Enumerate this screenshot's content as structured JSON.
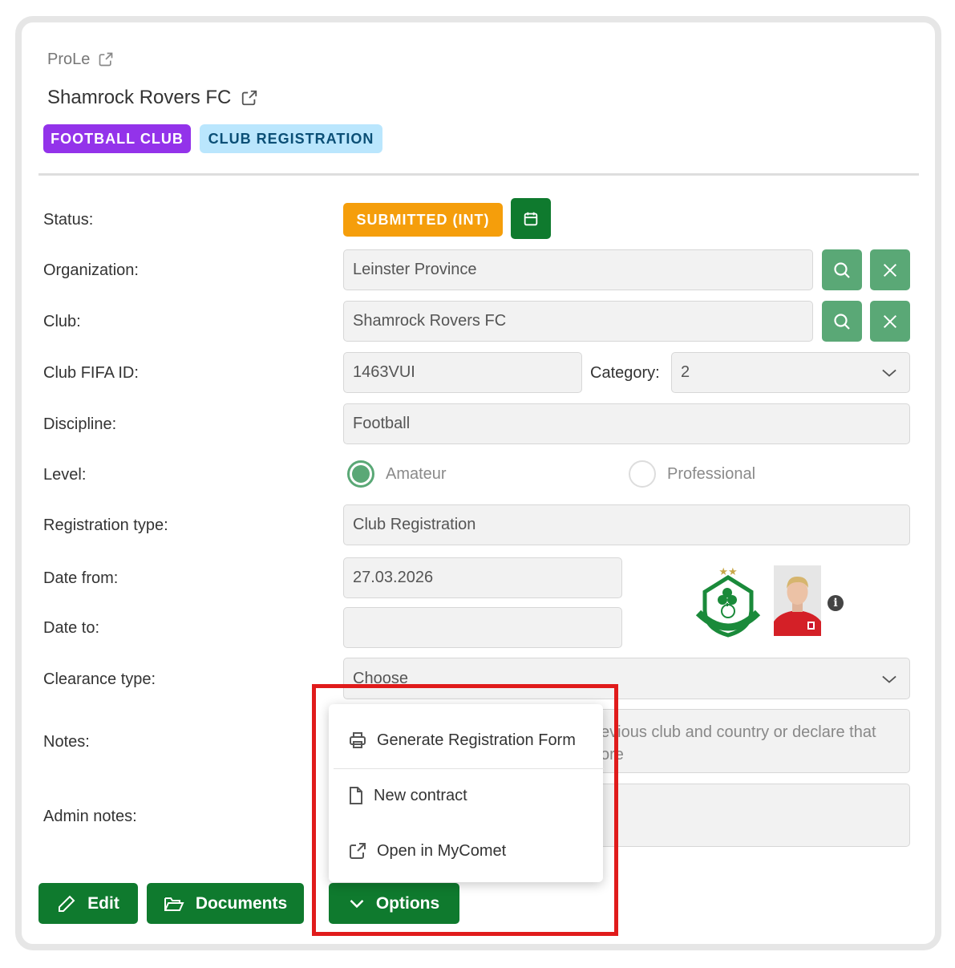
{
  "breadcrumb": {
    "text": "ProLe"
  },
  "header": {
    "title": "Shamrock Rovers FC",
    "badges": [
      "FOOTBALL CLUB",
      "CLUB REGISTRATION"
    ]
  },
  "form": {
    "status": {
      "label": "Status:",
      "value": "SUBMITTED (INT)"
    },
    "organization": {
      "label": "Organization:",
      "value": "Leinster Province"
    },
    "club": {
      "label": "Club:",
      "value": "Shamrock Rovers FC"
    },
    "club_fifa_id": {
      "label": "Club FIFA ID:",
      "value": "1463VUI"
    },
    "category": {
      "label": "Category:",
      "value": "2"
    },
    "discipline": {
      "label": "Discipline:",
      "value": "Football"
    },
    "level": {
      "label": "Level:",
      "options": [
        "Amateur",
        "Professional"
      ],
      "selected": "Amateur"
    },
    "registration_type": {
      "label": "Registration type:",
      "value": "Club Registration"
    },
    "date_from": {
      "label": "Date from:",
      "value": "27.03.2026"
    },
    "date_to": {
      "label": "Date to:",
      "value": ""
    },
    "clearance_type": {
      "label": "Clearance type:",
      "placeholder": "Choose"
    },
    "notes": {
      "label": "Notes:",
      "visible_text_line1": "evious club and country or declare that",
      "visible_text_line2": "ore"
    },
    "admin_notes": {
      "label": "Admin notes:",
      "value": ""
    }
  },
  "actions": {
    "edit": "Edit",
    "documents": "Documents",
    "options": "Options"
  },
  "options_menu": {
    "items": [
      "Generate Registration Form",
      "New contract",
      "Open in MyComet"
    ]
  },
  "colors": {
    "primary_green": "#0f7a2e",
    "light_green": "#5aa876",
    "status_orange": "#f59e0b",
    "badge_purple": "#9333ea",
    "badge_blue": "#bae6fd",
    "highlight_red": "#e01b1b"
  }
}
